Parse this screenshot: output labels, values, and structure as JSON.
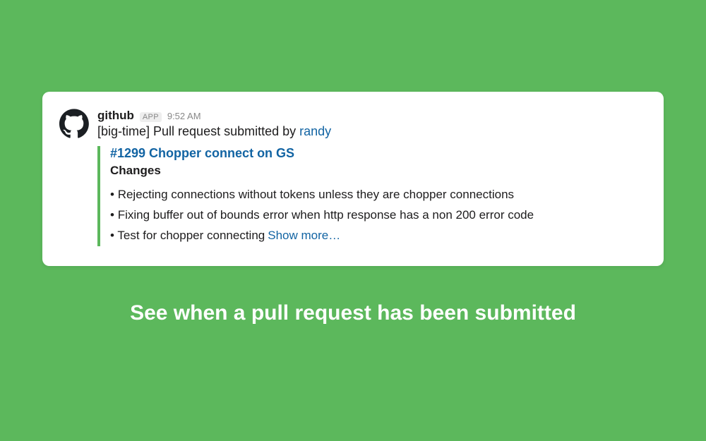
{
  "message": {
    "sender": "github",
    "app_badge": "APP",
    "timestamp": "9:52 AM",
    "subject_prefix": "[big-time] Pull request submitted by ",
    "subject_user": "randy"
  },
  "attachment": {
    "pr_title": "#1299 Chopper connect on GS",
    "subhead": "Changes",
    "bullets": [
      "Rejecting connections without tokens unless they are chopper connections",
      "Fixing buffer out of bounds error when http response has a non 200 error code",
      "Test for chopper connecting"
    ],
    "show_more": "Show more…"
  },
  "caption": "See when a pull request has been submitted"
}
